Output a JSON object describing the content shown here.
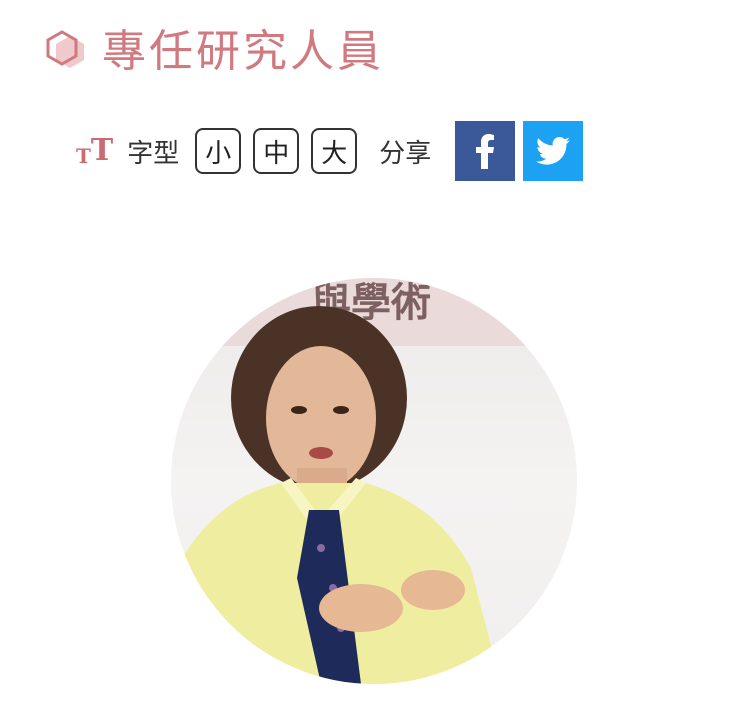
{
  "page": {
    "title": "專任研究人員"
  },
  "toolbar": {
    "font_label": "字型",
    "sizes": {
      "small": "小",
      "medium": "中",
      "large": "大"
    },
    "share_label": "分享"
  },
  "icons": {
    "heading": "hexagon-icon",
    "font_size": "font-size-icon",
    "facebook": "facebook-icon",
    "twitter": "twitter-icon"
  },
  "photo": {
    "banner_text": "與學術"
  },
  "colors": {
    "accent": "#d07a7f",
    "facebook": "#3b5998",
    "twitter": "#1da1f2"
  }
}
